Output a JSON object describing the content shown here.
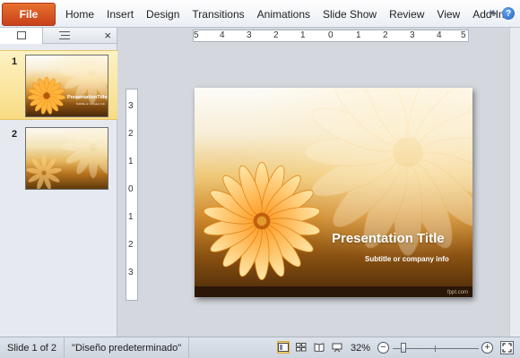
{
  "ribbon": {
    "file_label": "File",
    "tabs": [
      "Home",
      "Insert",
      "Design",
      "Transitions",
      "Animations",
      "Slide Show",
      "Review",
      "View",
      "Add-Ins"
    ],
    "help_label": "?"
  },
  "left_pane": {
    "close_label": "×",
    "slides": [
      {
        "number": "1",
        "title": "PresentationTitle",
        "subtitle": "Subtitle or company info",
        "selected": true
      },
      {
        "number": "2",
        "selected": false
      }
    ]
  },
  "ruler": {
    "horizontal_ticks": [
      "5",
      "4",
      "3",
      "2",
      "1",
      "0",
      "1",
      "2",
      "3",
      "4",
      "5"
    ],
    "vertical_ticks": [
      "3",
      "2",
      "1",
      "0",
      "1",
      "2",
      "3"
    ]
  },
  "slide": {
    "title": "Presentation Title",
    "subtitle": "Subtitle or company info",
    "credit": "fppt.com"
  },
  "status": {
    "slide_info": "Slide 1 of 2",
    "theme": "\"Diseño predeterminado\"",
    "zoom": "32%",
    "zoom_fraction": 0.32
  },
  "colors": {
    "file_tab": "#d9531e",
    "selected_thumb": "#f8dc83",
    "daisy_petal": "#ffb43c",
    "daisy_center": "#b8580c"
  }
}
